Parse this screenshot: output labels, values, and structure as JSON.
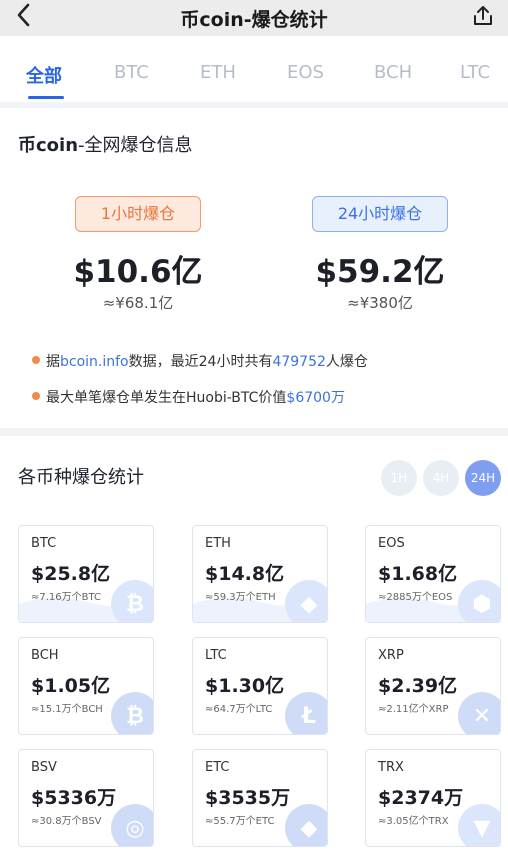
{
  "header": {
    "title": "币coin-爆仓统计",
    "back_icon": "chevron-left-icon",
    "share_icon": "share-icon"
  },
  "tabs": [
    "全部",
    "BTC",
    "ETH",
    "EOS",
    "BCH",
    "LTC"
  ],
  "summary": {
    "title_brand": "币coin",
    "title_rest": "-全网爆仓信息",
    "hour": {
      "label": "1小时爆仓",
      "value": "$10.6亿",
      "cny": "≈¥68.1亿"
    },
    "day": {
      "label": "24小时爆仓",
      "value": "$59.2亿",
      "cny": "≈¥380亿"
    },
    "note1": {
      "pre": "据",
      "link": "bcoin.info",
      "mid": "数据，最近24小时共有",
      "count": "479752",
      "post": "人爆仓"
    },
    "note2": {
      "pre": "最大单笔爆仓单发生在Huobi-BTC价值",
      "amount": "$6700万"
    }
  },
  "coins_section": {
    "title": "各币种爆仓统计",
    "time_buttons": [
      "1H",
      "4H",
      "24H"
    ],
    "active_time": "24H"
  },
  "coins": [
    {
      "name": "BTC",
      "value": "$25.8亿",
      "amount": "≈7.16万个BTC",
      "icon": "bitcoin-icon"
    },
    {
      "name": "ETH",
      "value": "$14.8亿",
      "amount": "≈59.3万个ETH",
      "icon": "ethereum-icon"
    },
    {
      "name": "EOS",
      "value": "$1.68亿",
      "amount": "≈2885万个EOS",
      "icon": "eos-icon"
    },
    {
      "name": "BCH",
      "value": "$1.05亿",
      "amount": "≈15.1万个BCH",
      "icon": "bitcoin-cash-icon"
    },
    {
      "name": "LTC",
      "value": "$1.30亿",
      "amount": "≈64.7万个LTC",
      "icon": "litecoin-icon"
    },
    {
      "name": "XRP",
      "value": "$2.39亿",
      "amount": "≈2.11亿个XRP",
      "icon": "xrp-icon"
    },
    {
      "name": "BSV",
      "value": "$5336万",
      "amount": "≈30.8万个BSV",
      "icon": "bsv-icon"
    },
    {
      "name": "ETC",
      "value": "$3535万",
      "amount": "≈55.7万个ETC",
      "icon": "ethereum-classic-icon"
    },
    {
      "name": "TRX",
      "value": "$2374万",
      "amount": "≈3.05亿个TRX",
      "icon": "tron-icon"
    }
  ],
  "colors": {
    "accent": "#2a64e8",
    "orange": "#e8773f"
  }
}
